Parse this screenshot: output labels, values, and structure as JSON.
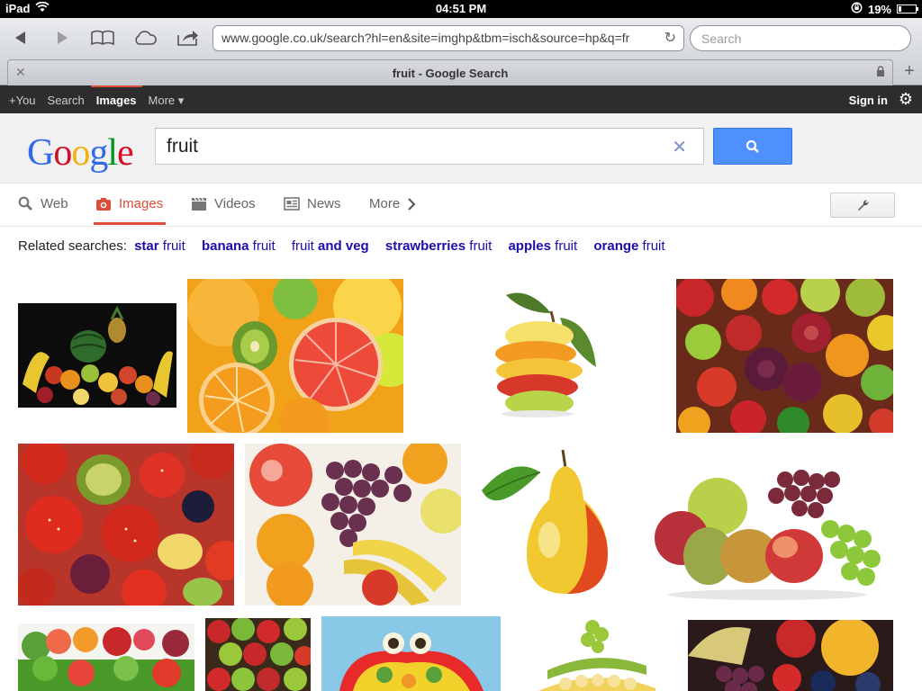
{
  "status_bar": {
    "device": "iPad",
    "time": "04:51 PM",
    "battery": "19%",
    "battery_level": 0.19
  },
  "browser": {
    "url": "www.google.co.uk/search?hl=en&site=imghp&tbm=isch&source=hp&q=fr",
    "search_placeholder": "Search",
    "tab_title": "fruit - Google Search"
  },
  "gbar": {
    "items": [
      "+You",
      "Search",
      "Images",
      "More ▾"
    ],
    "active_index": 2,
    "signin": "Sign in"
  },
  "logo": "Google",
  "query": "fruit",
  "tabs": [
    {
      "label": "Web",
      "icon": "search-icon"
    },
    {
      "label": "Images",
      "icon": "camera-icon",
      "active": true
    },
    {
      "label": "Videos",
      "icon": "film-icon"
    },
    {
      "label": "News",
      "icon": "newspaper-icon"
    },
    {
      "label": "More",
      "icon": "chevron-right-icon"
    }
  ],
  "related": {
    "prefix": "Related searches:",
    "items": [
      {
        "bold": "star",
        "rest": " fruit"
      },
      {
        "bold": "banana",
        "rest": " fruit"
      },
      {
        "pre": "fruit ",
        "bold": "and veg"
      },
      {
        "bold": "strawberries",
        "rest": " fruit"
      },
      {
        "bold": "apples",
        "rest": " fruit"
      },
      {
        "bold": "orange",
        "rest": " fruit"
      }
    ]
  },
  "colors": {
    "accent_red": "#dd4b39",
    "link_blue": "#1a0dab",
    "button_blue": "#4d90fe"
  }
}
